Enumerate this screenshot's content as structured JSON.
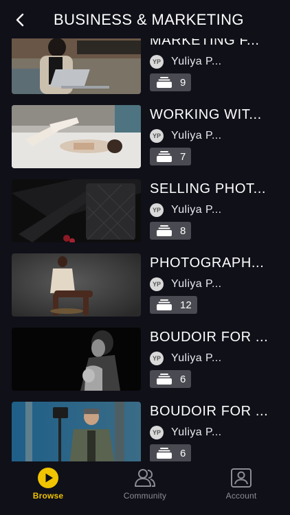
{
  "header": {
    "title": "BUSINESS & MARKETING",
    "back_icon": "chevron-left-icon"
  },
  "courses": [
    {
      "title": "MARKETING F...",
      "author_initials": "YP",
      "author": "Yuliya P...",
      "lesson_count": "9"
    },
    {
      "title": "WORKING WIT...",
      "author_initials": "YP",
      "author": "Yuliya P...",
      "lesson_count": "7"
    },
    {
      "title": "SELLING PHOT...",
      "author_initials": "YP",
      "author": "Yuliya P...",
      "lesson_count": "8"
    },
    {
      "title": "PHOTOGRAPH...",
      "author_initials": "YP",
      "author": "Yuliya P...",
      "lesson_count": "12"
    },
    {
      "title": "BOUDOIR FOR ...",
      "author_initials": "YP",
      "author": "Yuliya P...",
      "lesson_count": "6"
    },
    {
      "title": "BOUDOIR FOR ...",
      "author_initials": "YP",
      "author": "Yuliya P...",
      "lesson_count": "6"
    }
  ],
  "tabs": [
    {
      "label": "Browse",
      "icon": "play-circle-icon",
      "active": true
    },
    {
      "label": "Community",
      "icon": "people-icon",
      "active": false
    },
    {
      "label": "Account",
      "icon": "account-card-icon",
      "active": false
    }
  ],
  "colors": {
    "background": "#101019",
    "accent": "#f0c400",
    "badge": "#4a4a52",
    "inactive_tab": "#8d8d96"
  }
}
